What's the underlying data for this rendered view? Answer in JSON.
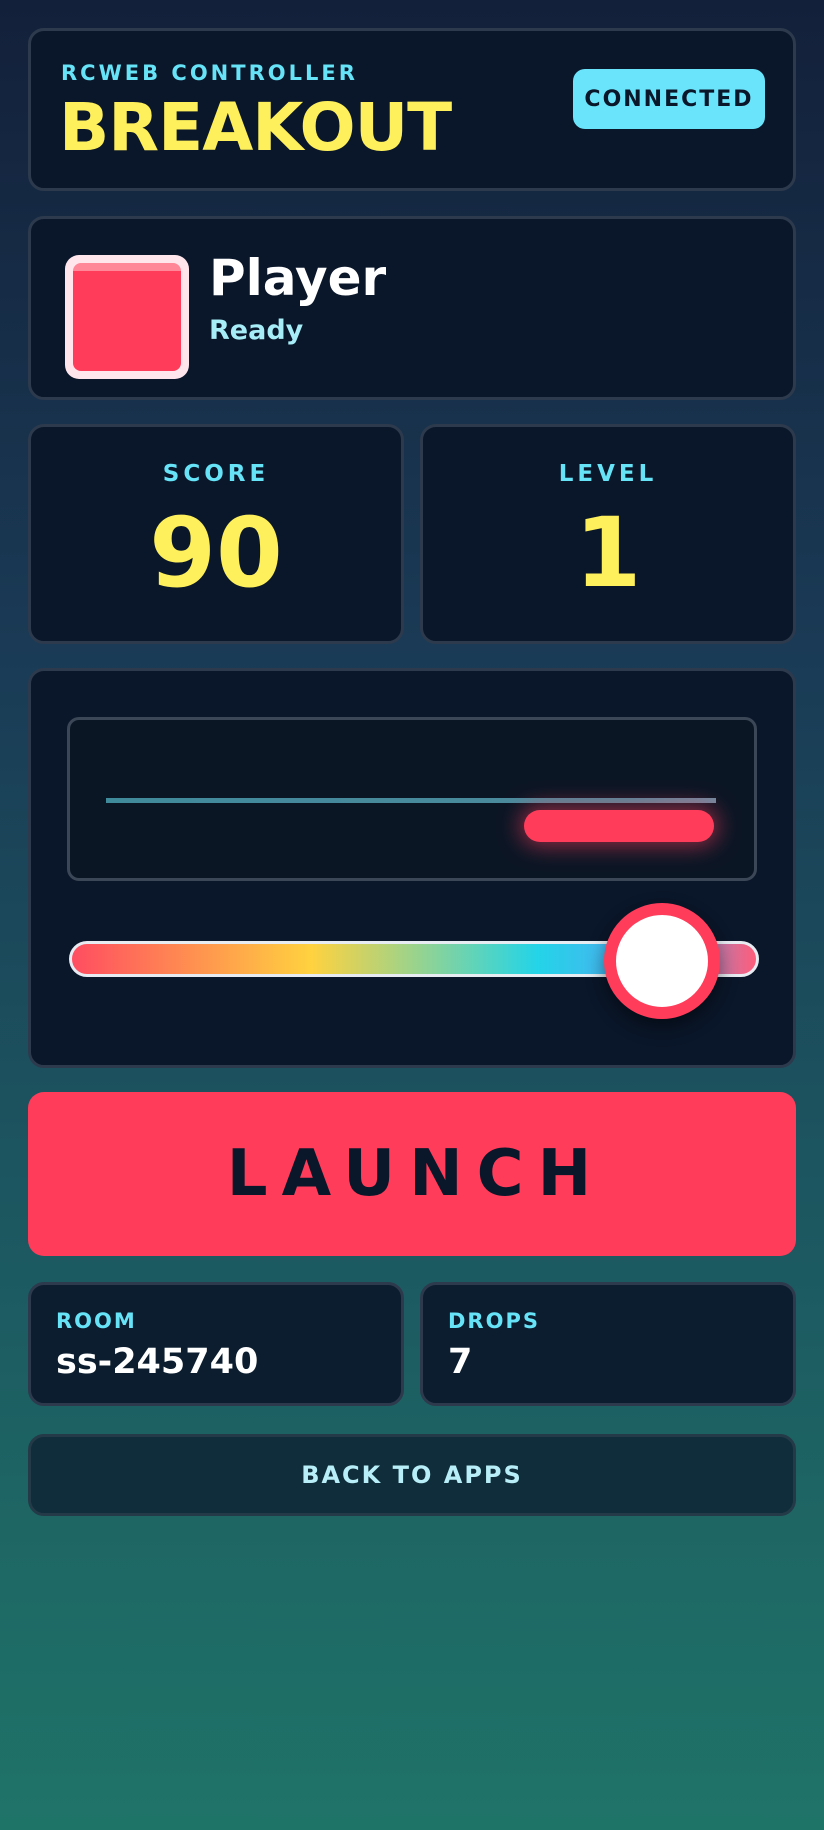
{
  "header": {
    "eyebrow": "RCWEB CONTROLLER",
    "title": "BREAKOUT",
    "status_badge": "CONNECTED"
  },
  "player": {
    "name": "Player",
    "status": "Ready",
    "color": "#ff3c5a"
  },
  "stats": {
    "score": {
      "label": "SCORE",
      "value": "90"
    },
    "level": {
      "label": "LEVEL",
      "value": "1"
    }
  },
  "control": {
    "paddle_position": 0.92,
    "paddle_color": "#ff3c5a"
  },
  "launch_label": "LAUNCH",
  "info": {
    "room": {
      "label": "ROOM",
      "value": "ss-245740"
    },
    "drops": {
      "label": "DROPS",
      "value": "7"
    }
  },
  "back_label": "BACK TO APPS",
  "colors": {
    "accent": "#ff3c5a",
    "highlight": "#fdf05c",
    "cyan": "#67e3f8"
  }
}
